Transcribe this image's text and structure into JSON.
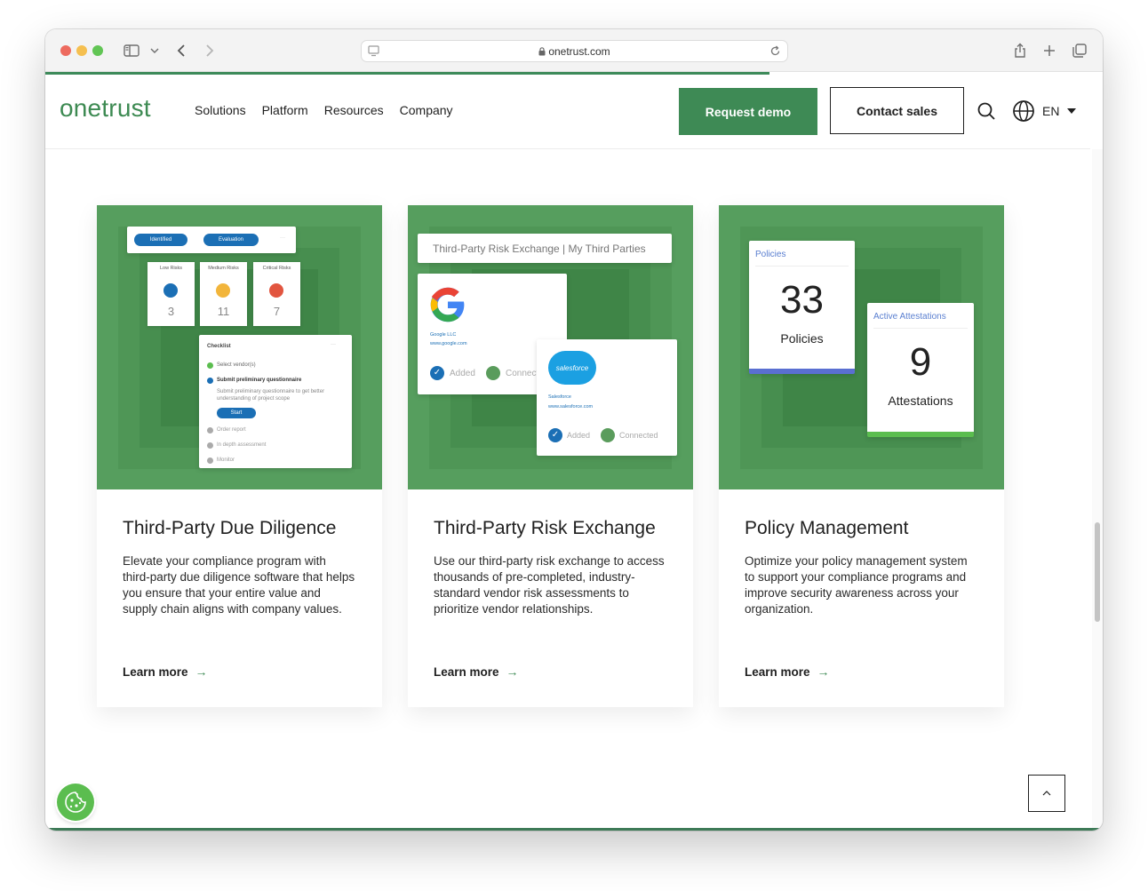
{
  "browser": {
    "url": "onetrust.com",
    "icons": [
      "sidebar-icon",
      "chevron-down-icon",
      "back-icon",
      "forward-icon",
      "reader-icon",
      "lock-icon",
      "reload-icon",
      "share-icon",
      "plus-icon",
      "tabs-icon"
    ]
  },
  "nav": {
    "logo": "onetrust",
    "menu": [
      "Solutions",
      "Platform",
      "Resources",
      "Company"
    ],
    "request_demo": "Request demo",
    "contact_sales": "Contact sales",
    "language": "EN"
  },
  "colors": {
    "brand_green": "#3e8a55",
    "image_green": "#569e5e",
    "accent_blue": "#1b6fb5"
  },
  "cards": [
    {
      "title": "Third-Party Due Diligence",
      "description": "Elevate your compliance program with third-party due diligence software that helps you ensure that your entire value and supply chain aligns with company values.",
      "link": "Learn more",
      "mock": {
        "steps": [
          "Identified",
          "Evaluation"
        ],
        "risks": [
          {
            "label": "Low Risks",
            "value": "3"
          },
          {
            "label": "Medium Risks",
            "value": "11"
          },
          {
            "label": "Critical Risks",
            "value": "7"
          }
        ],
        "checklist_title": "Checklist",
        "checklist": [
          "Select vendor(s)",
          "Submit preliminary questionnaire",
          "Submit preliminary questionnaire to get better understanding of project scope",
          "Order report",
          "In depth assessment",
          "Monitor"
        ],
        "start": "Start"
      }
    },
    {
      "title": "Third-Party Risk Exchange",
      "description": "Use our third-party risk exchange to access thousands of pre-completed, industry-standard vendor risk assessments to prioritize vendor relationships.",
      "link": "Learn more",
      "mock": {
        "header": "Third-Party Risk Exchange | My Third Parties",
        "google_name": "Google LLC",
        "google_url": "www.google.com",
        "salesforce_logo": "salesforce",
        "salesforce_name": "Salesforce",
        "salesforce_url": "www.salesforce.com",
        "added": "Added",
        "connect_partial": "Connect",
        "connected": "Connected"
      }
    },
    {
      "title": "Policy Management",
      "description": "Optimize your policy management system to support your compliance programs and improve security awareness across your organization.",
      "link": "Learn more",
      "mock": {
        "policies_header": "Policies",
        "policies_count": "33",
        "policies_label": "Policies",
        "attest_header": "Active Attestations",
        "attest_count": "9",
        "attest_label": "Attestations"
      }
    }
  ]
}
